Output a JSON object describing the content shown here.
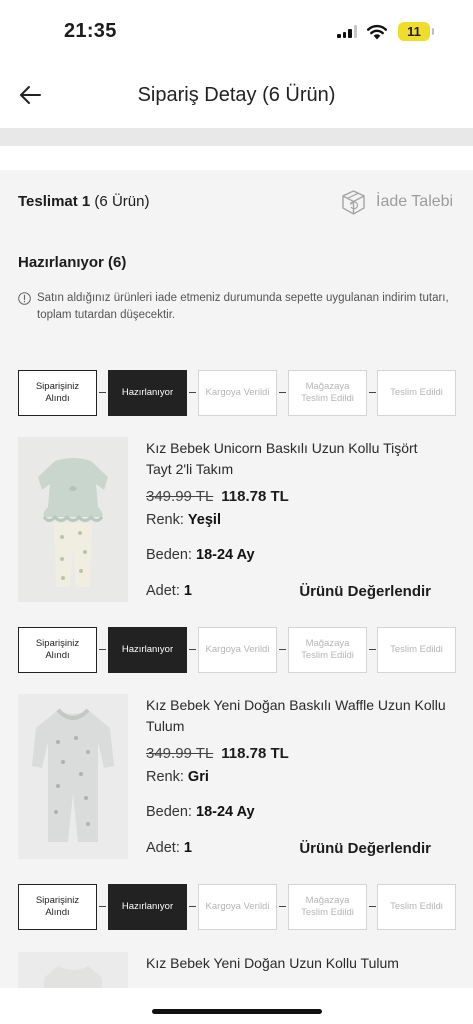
{
  "status_bar": {
    "time": "21:35",
    "battery": "11"
  },
  "header": {
    "title": "Sipariş Detay (6 Ürün)"
  },
  "delivery": {
    "title_bold": "Teslimat 1",
    "title_rest": " (6 Ürün)",
    "return_label": "İade Talebi"
  },
  "status_group": {
    "title": "Hazırlanıyor (6)",
    "info": "Satın aldığınız ürünleri iade etmeniz durumunda sepette uygulanan indirim tutarı, toplam tutardan düşecektir."
  },
  "steps": [
    "Siparişiniz Alındı",
    "Hazırlanıyor",
    "Kargoya Verildi",
    "Mağazaya Teslim Edildi",
    "Teslim Edildi"
  ],
  "labels": {
    "color": "Renk:",
    "size": "Beden:",
    "qty": "Adet:",
    "review": "Ürünü Değerlendir"
  },
  "products": [
    {
      "name": "Kız Bebek Unicorn Baskılı Uzun Kollu Tişört Tayt 2'li Takım",
      "old_price": "349.99 TL",
      "new_price": "118.78 TL",
      "color": "Yeşil",
      "size": "18-24 Ay",
      "qty": "1"
    },
    {
      "name": "Kız Bebek Yeni Doğan Baskılı Waffle Uzun Kollu Tulum",
      "old_price": "349.99 TL",
      "new_price": "118.78 TL",
      "color": "Gri",
      "size": "18-24 Ay",
      "qty": "1"
    },
    {
      "name": "Kız Bebek Yeni Doğan Uzun Kollu Tulum"
    }
  ],
  "colors": {
    "accent_dark": "#222222",
    "step_inactive": "#b5b5b5",
    "battery": "#f0dc2b"
  }
}
